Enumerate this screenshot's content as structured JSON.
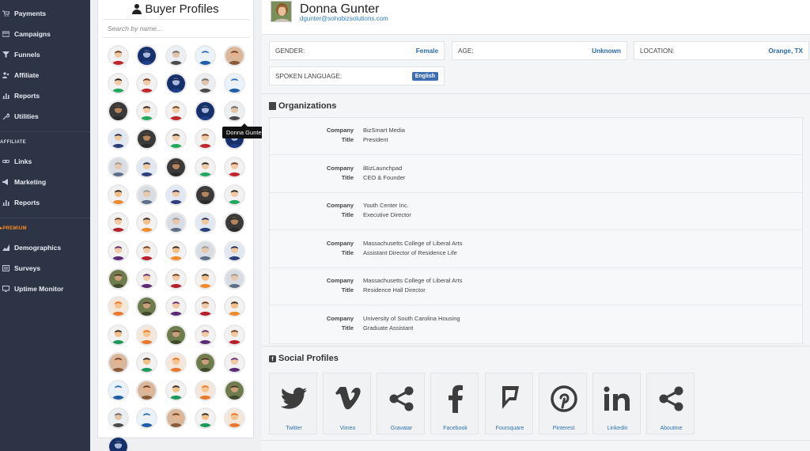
{
  "sidebar": {
    "top_items": [
      {
        "label": "Payments",
        "icon": "cart-icon"
      },
      {
        "label": "Campaigns",
        "icon": "campaigns-icon"
      },
      {
        "label": "Funnels",
        "icon": "funnel-icon"
      },
      {
        "label": "Affiliate",
        "icon": "affiliate-icon"
      },
      {
        "label": "Reports",
        "icon": "bar-chart-icon"
      },
      {
        "label": "Utilities",
        "icon": "wrench-icon"
      }
    ],
    "affiliate_section": "AFFILIATE",
    "affiliate_items": [
      {
        "label": "Links",
        "icon": "link-icon"
      },
      {
        "label": "Marketing",
        "icon": "megaphone-icon"
      },
      {
        "label": "Reports",
        "icon": "bar-chart-icon"
      }
    ],
    "premium_section": "PREMIUM",
    "premium_items": [
      {
        "label": "Demographics",
        "icon": "demographics-icon"
      },
      {
        "label": "Surveys",
        "icon": "surveys-icon"
      },
      {
        "label": "Uptime Monitor",
        "icon": "monitor-icon"
      }
    ],
    "premium_color": "#ff8a1f"
  },
  "buyers": {
    "title": "Buyer Profiles",
    "search_placeholder": "Search by name...",
    "tooltip": "Donna Gunter",
    "avatar_count": 71
  },
  "profile": {
    "name": "Donna Gunter",
    "email": "dgunter@sohobizsolutions.com",
    "gender_label": "GENDER:",
    "gender_value": "Female",
    "age_label": "AGE:",
    "age_value": "Unknown",
    "location_label": "LOCATION:",
    "location_value": "Orange, TX",
    "language_label": "SPOKEN LANGUAGE:",
    "language_value": "English"
  },
  "organizations": {
    "title": "Organizations",
    "company_label": "Company",
    "title_label": "Title",
    "rows": [
      {
        "company": "BizSmart Media",
        "title": "President"
      },
      {
        "company": "iBizLaunchpad",
        "title": "CEO & Founder"
      },
      {
        "company": "Youth Center Inc.",
        "title": "Executive Director"
      },
      {
        "company": "Massachusetts College of Liberal Arts",
        "title": "Assistant Director of Residence Life"
      },
      {
        "company": "Massachusetts College of Liberal Arts",
        "title": "Residence Hall Director"
      },
      {
        "company": "University of South Carolina Housing",
        "title": "Graduate Assistant"
      }
    ]
  },
  "social": {
    "title": "Social Profiles",
    "items": [
      {
        "label": "Twitter",
        "icon": "twitter-icon"
      },
      {
        "label": "Vimeo",
        "icon": "vimeo-icon"
      },
      {
        "label": "Gravatar",
        "icon": "share-icon"
      },
      {
        "label": "Facebook",
        "icon": "facebook-icon"
      },
      {
        "label": "Foursquare",
        "icon": "foursquare-icon"
      },
      {
        "label": "Pinterest",
        "icon": "pinterest-icon"
      },
      {
        "label": "Linkedin",
        "icon": "linkedin-icon"
      },
      {
        "label": "Aboutme",
        "icon": "share-icon"
      }
    ]
  },
  "colors": {
    "sidebar_bg": "#2c3446",
    "link_blue": "#2a6aa8",
    "badge_blue": "#3d6fb0"
  }
}
